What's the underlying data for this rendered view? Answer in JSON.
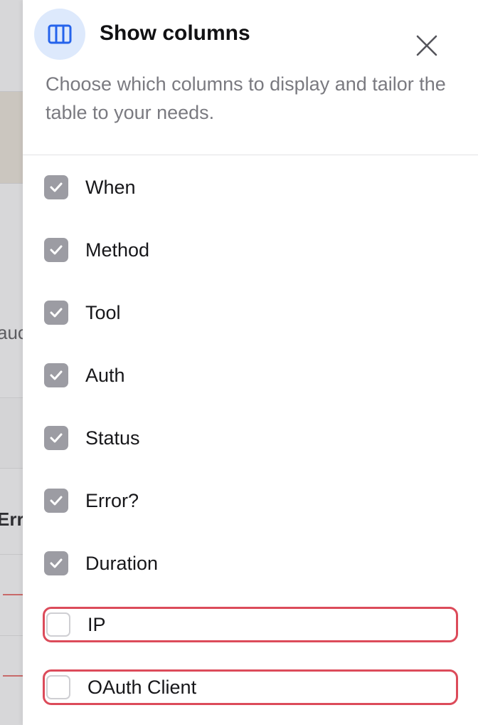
{
  "background": {
    "fragments": [
      "auc",
      "Err"
    ]
  },
  "drawer": {
    "title": "Show columns",
    "description": "Choose which columns to display and tailor the table to your needs.",
    "icon": "columns-icon",
    "close_icon": "close-icon"
  },
  "columns": [
    {
      "label": "When",
      "checked": true
    },
    {
      "label": "Method",
      "checked": true
    },
    {
      "label": "Tool",
      "checked": true
    },
    {
      "label": "Auth",
      "checked": true
    },
    {
      "label": "Status",
      "checked": true
    },
    {
      "label": "Error?",
      "checked": true
    },
    {
      "label": "Duration",
      "checked": true
    },
    {
      "label": "IP",
      "checked": false,
      "highlighted": true
    },
    {
      "label": "OAuth Client",
      "checked": false,
      "highlighted": true
    }
  ],
  "colors": {
    "accent": "#2563eb",
    "icon_bg": "#dde9fc",
    "checked": "#9c9ca3",
    "highlight": "#dc4b5a"
  }
}
